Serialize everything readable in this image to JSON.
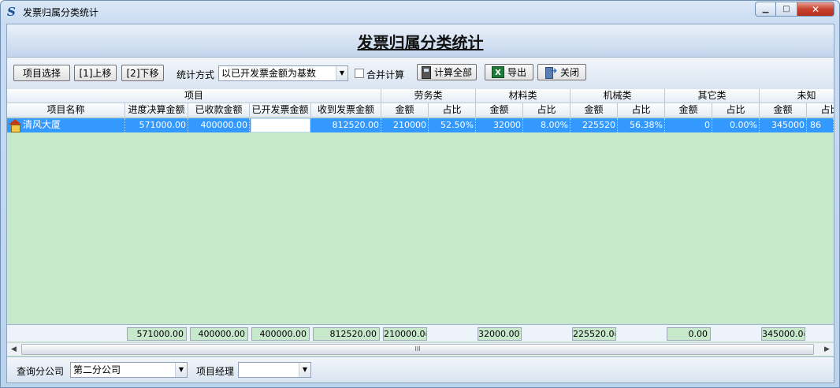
{
  "window": {
    "title": "发票归属分类统计",
    "app_icon": "S"
  },
  "banner": {
    "title": "发票归属分类统计"
  },
  "toolbar": {
    "select_project": "项目选择",
    "move_up": "[1]上移",
    "move_down": "[2]下移",
    "stat_mode_label": "统计方式",
    "stat_mode_value": "以已开发票金额为基数",
    "merge_calc_label": "合并计算",
    "merge_calc_checked": false,
    "calc_all": "计算全部",
    "export": "导出",
    "close": "关闭"
  },
  "grid": {
    "groups": [
      "项目",
      "劳务类",
      "材料类",
      "机械类",
      "其它类",
      "未知"
    ],
    "columns": [
      "项目名称",
      "进度决算金额",
      "已收款金额",
      "已开发票金额",
      "收到发票金额",
      "金额",
      "占比",
      "金额",
      "占比",
      "金额",
      "占比",
      "金额",
      "占比",
      "金额",
      "占比"
    ],
    "rows": [
      {
        "name": "清风大厦",
        "progress": "571000.00",
        "received": "400000.00",
        "invoiced": "",
        "invoice_received": "812520.00",
        "labor_amt": "210000",
        "labor_pct": "52.50%",
        "material_amt": "32000",
        "material_pct": "8.00%",
        "machine_amt": "225520",
        "machine_pct": "56.38%",
        "other_amt": "0",
        "other_pct": "0.00%",
        "unknown_amt": "345000",
        "unknown_pct": "86"
      }
    ],
    "totals": {
      "progress": "571000.00",
      "received": "400000.00",
      "invoiced": "400000.00",
      "invoice_received": "812520.00",
      "labor": "210000.0(",
      "material": "32000.00",
      "machine": "225520.0(",
      "other": "0.00",
      "unknown": "345000.0("
    },
    "scroll_grip": "III"
  },
  "footer": {
    "branch_label": "查询分公司",
    "branch_value": "第二分公司",
    "manager_label": "项目经理",
    "manager_value": ""
  },
  "colors": {
    "grid_bg": "#c8e8cc",
    "selected_row": "#3399ff"
  }
}
